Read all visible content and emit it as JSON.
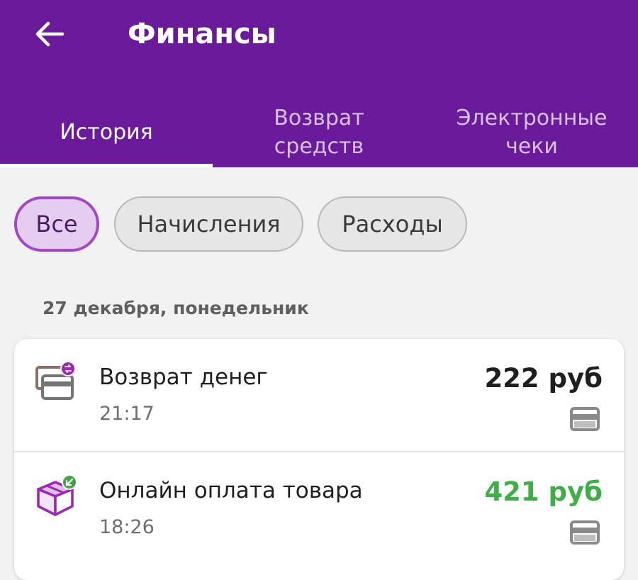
{
  "header": {
    "title": "Финансы",
    "back_icon": "arrow-left-icon",
    "background": "#6a1b9a"
  },
  "tabs": [
    {
      "label": "История",
      "active": true
    },
    {
      "label": "Возврат\nсредств",
      "active": false
    },
    {
      "label": "Электронные\nчеки",
      "active": false
    }
  ],
  "filters": [
    {
      "label": "Все",
      "active": true
    },
    {
      "label": "Начисления",
      "active": false
    },
    {
      "label": "Расходы",
      "active": false
    }
  ],
  "date_header": "27 декабря, понедельник",
  "transactions": [
    {
      "icon": "refund-card-icon",
      "title": "Возврат денег",
      "time": "21:17",
      "amount": "222 руб",
      "amount_color": "#1f1f1f",
      "payment_icon": "card-icon"
    },
    {
      "icon": "package-incoming-icon",
      "title": "Онлайн оплата товара",
      "time": "18:26",
      "amount": "421 руб",
      "amount_color": "#3fae49",
      "payment_icon": "card-icon"
    }
  ]
}
